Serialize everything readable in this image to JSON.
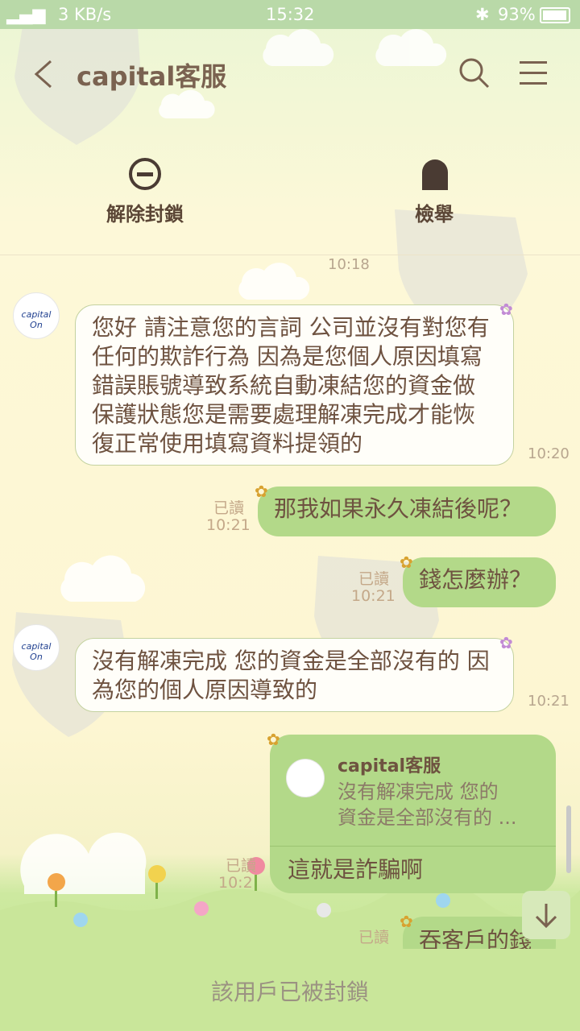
{
  "status_bar": {
    "network": "4G",
    "speed": "3 KB/s",
    "time": "15:32",
    "battery": "93%"
  },
  "header": {
    "title": "capital客服",
    "back_icon": "chevron-left-icon",
    "search_icon": "search-icon",
    "menu_icon": "menu-icon"
  },
  "actions": {
    "unblock": "解除封鎖",
    "report": "檢舉"
  },
  "messages": {
    "t0": "10:18",
    "m1": {
      "avatar_text": "capital On",
      "text": "您好 請注意您的言詞 公司並沒有對您有任何的欺詐行為 因為是您個人原因填寫錯誤賬號導致系統自動凍結您的資金做保護狀態您是需要處理解凍完成才能恢復正常使用填寫資料提領的",
      "time": "10:20"
    },
    "m2": {
      "text": "那我如果永久凍結後呢？",
      "read": "已讀",
      "time": "10:21"
    },
    "m3": {
      "text": "錢怎麼辦？",
      "read": "已讀",
      "time": "10:21"
    },
    "m4": {
      "avatar_text": "capital On",
      "text": "沒有解凍完成 您的資金是全部沒有的 因為您的個人原因導致的",
      "time": "10:21"
    },
    "m5": {
      "quote_name": "capital客服",
      "quote_line1": "沒有解凍完成 您的",
      "quote_line2": "資金是全部沒有的 ...",
      "text": "這就是詐騙啊",
      "read": "已讀",
      "time": "10:2"
    },
    "m6": {
      "text": "吞客戶的錢",
      "read": "已讀"
    }
  },
  "footer": {
    "blocked_text": "該用戶已被封鎖"
  },
  "colors": {
    "bubble_out": "#b3d989",
    "bubble_in": "#fffef9",
    "text": "#6e5240",
    "status_bar": "#b9d9a8"
  }
}
